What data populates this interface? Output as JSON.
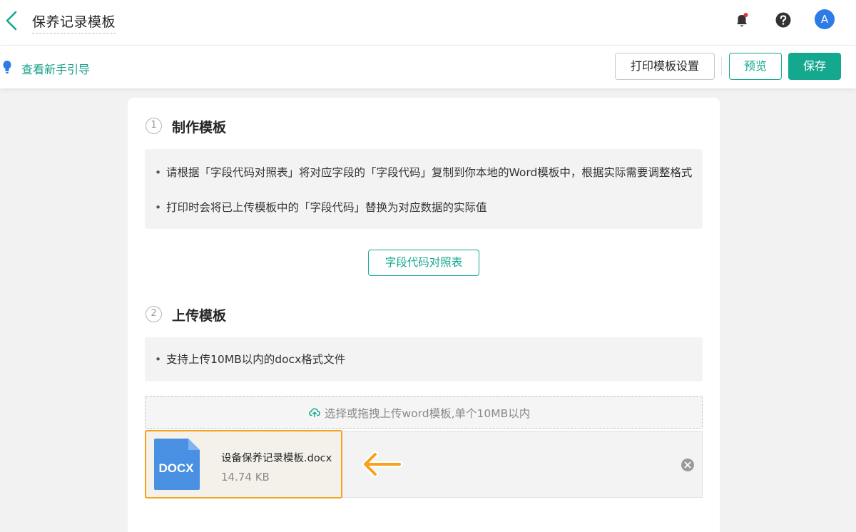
{
  "header": {
    "title": "保养记录模板",
    "avatar_letter": "A",
    "back_icon": "chevron-left-icon",
    "notification_icon": "bell-icon",
    "help_icon": "help-circle-icon"
  },
  "toolbar": {
    "guide_label": "查看新手引导",
    "guide_icon": "lightbulb-icon",
    "print_settings_label": "打印模板设置",
    "preview_label": "预览",
    "save_label": "保存"
  },
  "steps": {
    "step1": {
      "number": "1",
      "title": "制作模板",
      "bullets": [
        "请根据「字段代码对照表」将对应字段的「字段代码」复制到你本地的Word模板中，根据实际需要调整格式",
        "打印时会将已上传模板中的「字段代码」替换为对应数据的实际值"
      ],
      "button_label": "字段代码对照表"
    },
    "step2": {
      "number": "2",
      "title": "上传模板",
      "bullets": [
        "支持上传10MB以内的docx格式文件"
      ],
      "upload_hint": "选择或拖拽上传word模板,单个10MB以内",
      "upload_icon": "cloud-upload-icon"
    }
  },
  "file": {
    "name": "设备保养记录模板.docx",
    "size": "14.74 KB",
    "type_label": "DOCX",
    "remove_icon": "close-circle-icon",
    "annotation_icon": "arrow-left-icon"
  },
  "colors": {
    "accent": "#14a88f",
    "highlight": "#f5a21e",
    "doc_icon": "#4a90e2",
    "avatar": "#2d7be5",
    "bell_dot": "#e5342e"
  }
}
